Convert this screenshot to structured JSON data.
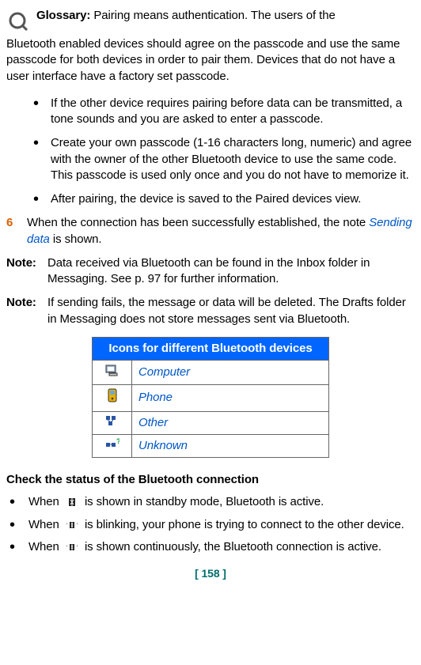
{
  "glossary": {
    "label": "Glossary:",
    "text_line1": "Pairing means authentication. The users of the",
    "text_rest": "Bluetooth enabled devices should agree on the passcode and use the same passcode for both devices in order to pair them. Devices that do not have a user interface have a factory set passcode."
  },
  "first_bullets": [
    "If the other device requires pairing before data can be transmitted, a tone sounds and you are asked to enter a passcode.",
    "Create your own passcode (1-16 characters long, numeric) and agree with the owner of the other Bluetooth device to use the same code. This passcode is used only once and you do not have to memorize it.",
    "After pairing, the device is saved to the Paired devices view."
  ],
  "step6": {
    "num": "6",
    "before": "When the connection has been successfully established, the note ",
    "highlight": "Sending data",
    "after": " is shown."
  },
  "notes": [
    {
      "label": "Note:",
      "body": "Data received via Bluetooth can be found in the Inbox folder in Messaging. See p. 97 for further information."
    },
    {
      "label": "Note:",
      "body": "If sending fails, the message or data will be deleted. The Drafts folder in Messaging does not store messages sent via Bluetooth."
    }
  ],
  "bt_table": {
    "header": "Icons for different Bluetooth devices",
    "rows": [
      {
        "icon": "computer-icon",
        "label": "Computer"
      },
      {
        "icon": "phone-icon",
        "label": "Phone"
      },
      {
        "icon": "other-icon",
        "label": "Other"
      },
      {
        "icon": "unknown-icon",
        "label": "Unknown"
      }
    ]
  },
  "status_section": {
    "heading": "Check the status of the Bluetooth connection",
    "items": [
      {
        "pre": "When ",
        "icon": "bt-standby-icon",
        "post": " is shown in standby mode, Bluetooth is active."
      },
      {
        "pre": "When ",
        "icon": "bt-blinking-icon",
        "post": " is blinking, your phone is trying to connect to the other device."
      },
      {
        "pre": "When ",
        "icon": "bt-continuous-icon",
        "post": " is shown continuously, the Bluetooth connection is active."
      }
    ]
  },
  "page_number": "[ 158 ]"
}
